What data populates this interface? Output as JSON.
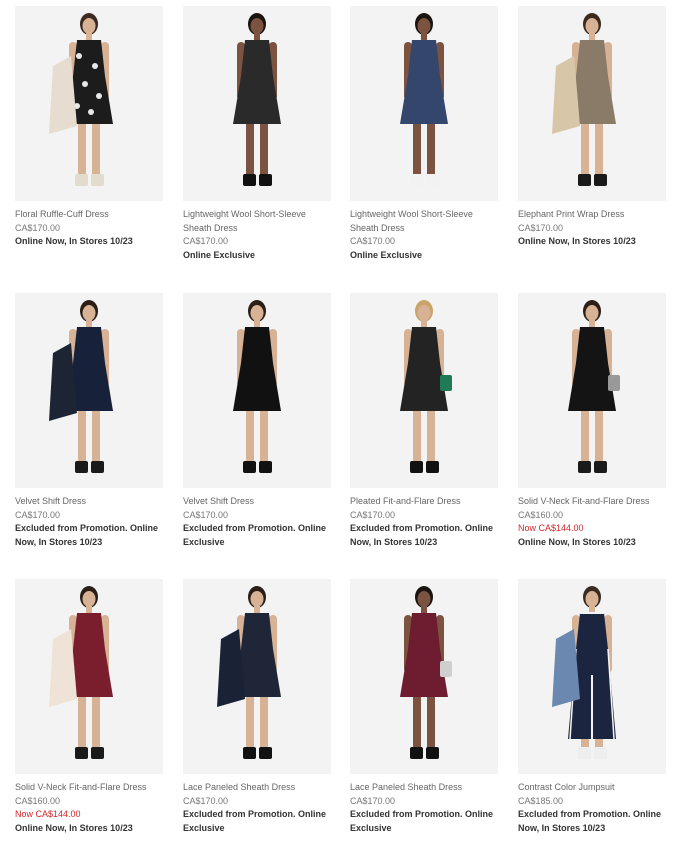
{
  "products": [
    {
      "name": "Floral Ruffle-Cuff Dress",
      "price": "CA$170.00",
      "sale": "",
      "note": "Online Now, In Stores 10/23",
      "colors": {
        "dress": "#1c1c1c",
        "pattern": "#e8e8e8",
        "coat": "#e6ddd0",
        "shoes": "#e2dccf",
        "skin": "#d7b295",
        "hair": "#3a2a20"
      }
    },
    {
      "name": "Lightweight Wool Short-Sleeve Sheath Dress",
      "price": "CA$170.00",
      "sale": "",
      "note": "Online Exclusive",
      "colors": {
        "dress": "#2a2a2a",
        "shoes": "#111111",
        "skin": "#7b5340",
        "hair": "#1a1410"
      }
    },
    {
      "name": "Lightweight Wool Short-Sleeve Sheath Dress",
      "price": "CA$170.00",
      "sale": "",
      "note": "Online Exclusive",
      "colors": {
        "dress": "#34466b",
        "shoes": "#f2f2f2",
        "skin": "#7b5340",
        "hair": "#1a1410"
      }
    },
    {
      "name": "Elephant Print Wrap Dress",
      "price": "CA$170.00",
      "sale": "",
      "note": "Online Now, In Stores 10/23",
      "colors": {
        "dress": "#8a7a68",
        "coat": "#d8c6a8",
        "shoes": "#1a1a1a",
        "skin": "#d7b295",
        "hair": "#3a2a20"
      }
    },
    {
      "name": "Velvet Shift Dress",
      "price": "CA$170.00",
      "sale": "",
      "note": "Excluded from Promotion. Online Now, In Stores 10/23",
      "colors": {
        "dress": "#17213a",
        "coat": "#1d2535",
        "shoes": "#1a1a1a",
        "skin": "#d7b295",
        "hair": "#2a1e16"
      }
    },
    {
      "name": "Velvet Shift Dress",
      "price": "CA$170.00",
      "sale": "",
      "note": "Excluded from Promotion. Online Exclusive",
      "colors": {
        "dress": "#111111",
        "shoes": "#111111",
        "skin": "#d7b295",
        "hair": "#2a1e16"
      }
    },
    {
      "name": "Pleated Fit-and-Flare Dress",
      "price": "CA$170.00",
      "sale": "",
      "note": "Excluded from Promotion. Online Now, In Stores 10/23",
      "colors": {
        "dress": "#232323",
        "bag": "#1f7a55",
        "shoes": "#111111",
        "skin": "#d7b295",
        "hair": "#c9a46a"
      }
    },
    {
      "name": "Solid V-Neck Fit-and-Flare Dress",
      "price": "CA$160.00",
      "sale": "Now CA$144.00",
      "note": "Online Now, In Stores 10/23",
      "colors": {
        "dress": "#141414",
        "bag": "#999999",
        "shoes": "#1a1a1a",
        "skin": "#d7b295",
        "hair": "#2a1e16"
      }
    },
    {
      "name": "Solid V-Neck Fit-and-Flare Dress",
      "price": "CA$160.00",
      "sale": "Now CA$144.00",
      "note": "Online Now, In Stores 10/23",
      "colors": {
        "dress": "#7a1e2e",
        "coat": "#eee3d6",
        "shoes": "#1a1a1a",
        "skin": "#d7b295",
        "hair": "#2a1e16"
      }
    },
    {
      "name": "Lace Paneled Sheath Dress",
      "price": "CA$170.00",
      "sale": "",
      "note": "Excluded from Promotion. Online Exclusive",
      "colors": {
        "dress": "#1e2638",
        "coat": "#1a2236",
        "shoes": "#111111",
        "skin": "#d7b295",
        "hair": "#2a1e16"
      }
    },
    {
      "name": "Lace Paneled Sheath Dress",
      "price": "CA$170.00",
      "sale": "",
      "note": "Excluded from Promotion. Online Exclusive",
      "colors": {
        "dress": "#6e1c30",
        "bag": "#cfcfcf",
        "shoes": "#111111",
        "skin": "#7b5340",
        "hair": "#1a1410"
      }
    },
    {
      "name": "Contrast Color Jumpsuit",
      "price": "CA$185.00",
      "sale": "",
      "note": "Excluded from Promotion. Online Now, In Stores 10/23",
      "colors": {
        "dress": "#1c2540",
        "trim": "#f5f5f5",
        "coat": "#6a88b0",
        "shoes": "#eeeeee",
        "skin": "#d7b295",
        "hair": "#3a2a20"
      }
    }
  ]
}
